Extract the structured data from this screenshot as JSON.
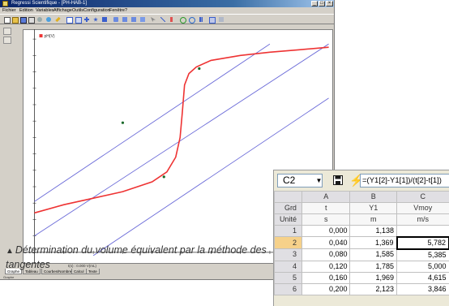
{
  "app": {
    "title": "Regressi Scientifique - [PH-HAB-1]",
    "menu": [
      "Fichier",
      "Edition",
      "Variables",
      "Affichage",
      "Outils",
      "Configuration",
      "Fenêtre",
      "?"
    ],
    "status": {
      "line1": "t(s) : 0.000 V(mL)",
      "line2": "= 0.000 , 0.000"
    },
    "sheet_tabs": [
      "Graphe",
      "Tableau",
      "Courbes/Nombre",
      "Calcul",
      "Texte"
    ],
    "bottom_text": "Graphe",
    "legend": "pH(V)"
  },
  "chart_data": {
    "type": "line",
    "title": "",
    "xlabel": "",
    "ylabel": "",
    "series": [
      {
        "name": "pH(V)",
        "color": "#ee3333",
        "x": [
          0,
          2,
          4,
          6,
          8,
          9,
          9.6,
          9.9,
          10.05,
          10.2,
          10.5,
          11,
          12,
          14,
          16,
          18,
          20
        ],
        "y": [
          2.4,
          2.9,
          3.3,
          3.7,
          4.3,
          4.9,
          5.8,
          7.0,
          8.5,
          10.2,
          10.9,
          11.3,
          11.7,
          12.0,
          12.2,
          12.35,
          12.5
        ]
      }
    ],
    "tangents": [
      {
        "x1": 0,
        "y1": 1.0,
        "x2": 20,
        "y2": 12.7,
        "color": "#6a6ad8"
      },
      {
        "x1": 0,
        "y1": 3.1,
        "x2": 16.0,
        "y2": 12.7,
        "color": "#6a6ad8"
      },
      {
        "x1": 4,
        "y1": -0.2,
        "x2": 20,
        "y2": 9.4,
        "color": "#6a6ad8"
      }
    ],
    "points": [
      {
        "x": 8.8,
        "y": 4.6
      },
      {
        "x": 11.2,
        "y": 11.2
      },
      {
        "x": 6.0,
        "y": 7.9
      }
    ],
    "xlim": [
      -0.8,
      20.3
    ],
    "ylim": [
      -0.7,
      13.6
    ]
  },
  "caption": "Détermination du volume équivalent par la méthode des tangentes",
  "sheet": {
    "cell_ref": "C2",
    "formula": "=(Y1[2]-Y1[1])/(t[2]-t[1])",
    "columns": [
      "A",
      "B",
      "C"
    ],
    "row_headers": [
      "Grd",
      "Unité",
      "1",
      "2",
      "3",
      "4",
      "5",
      "6"
    ],
    "rows": [
      [
        "t",
        "Y1",
        "Vmoy"
      ],
      [
        "s",
        "m",
        "m/s"
      ],
      [
        "0,000",
        "1,138",
        ""
      ],
      [
        "0,040",
        "1,369",
        "5,782"
      ],
      [
        "0,080",
        "1,585",
        "5,385"
      ],
      [
        "0,120",
        "1,785",
        "5,000"
      ],
      [
        "0,160",
        "1,969",
        "4,615"
      ],
      [
        "0,200",
        "2,123",
        "3,846"
      ]
    ]
  }
}
